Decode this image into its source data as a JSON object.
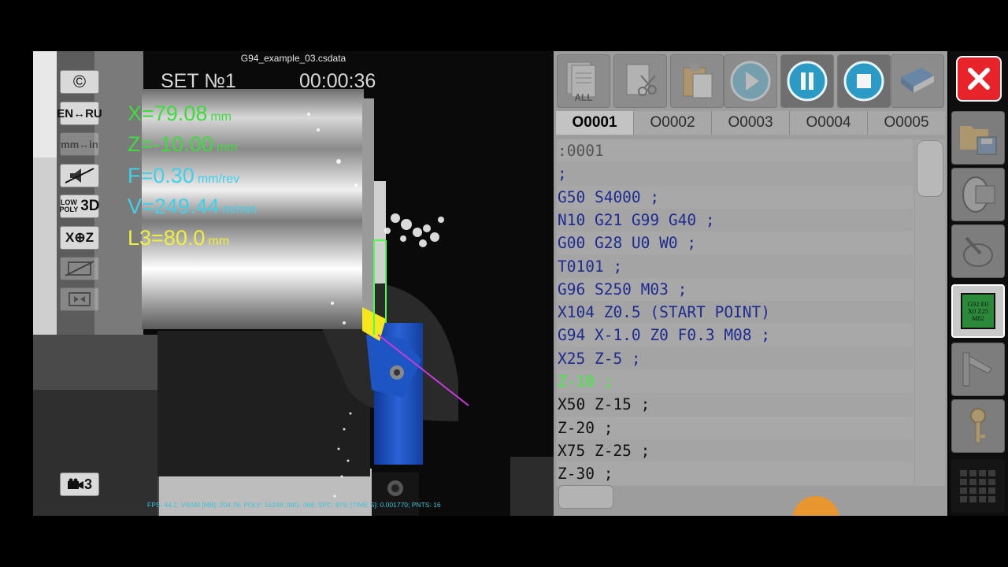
{
  "viewport": {
    "file_name": "G94_example_03.csdata",
    "set_label": "SET №1",
    "timer": "00:00:36",
    "readouts": {
      "x": {
        "text": "X=79.08",
        "unit": "mm",
        "color": "#3ddc3d"
      },
      "z": {
        "text": "Z=-10.00",
        "unit": "mm",
        "color": "#3ddc3d"
      },
      "f": {
        "text": "F=0.30",
        "unit": "mm/rev",
        "color": "#3fd0ea"
      },
      "v": {
        "text": "V=249.44",
        "unit": "m/min",
        "color": "#3fd0ea"
      },
      "l3": {
        "text": "L3=80.0",
        "unit": "mm",
        "color": "#f0f03a"
      }
    },
    "fps_line": "FPS: 44.2; VRAM [MB]: 204.78; POLY: 15249; IMG: 368; SPC: 879; [TIME S]: 0.001770; PNTS: 16",
    "left_buttons": {
      "copyright": "©",
      "lang": "EN↔RU",
      "units": "mm↔in",
      "low": "LOW",
      "poly": "POLY",
      "three_d": "3D",
      "axes": "X⊕Z",
      "camera_count": "3"
    }
  },
  "toolbar": {
    "all_label": "ALL",
    "icons": [
      "file-all-icon",
      "cut-icon",
      "paste-icon",
      "play-icon",
      "pause-icon",
      "stop-icon",
      "book-icon",
      "close-icon"
    ]
  },
  "program_tabs": [
    "O0001",
    "O0002",
    "O0003",
    "O0004",
    "O0005"
  ],
  "active_tab": "O0001",
  "code_lines": [
    {
      "text": ":0001",
      "color": "#555555"
    },
    {
      "text": ";",
      "color": "#1e2b8f"
    },
    {
      "text": "G50 S4000 ;",
      "color": "#1e2b8f"
    },
    {
      "text": "N10 G21 G99 G40 ;",
      "color": "#1e2b8f"
    },
    {
      "text": "G00 G28 U0 W0 ;",
      "color": "#1e2b8f"
    },
    {
      "text": "T0101 ;",
      "color": "#1e2b8f"
    },
    {
      "text": "G96 S250 M03 ;",
      "color": "#1e2b8f"
    },
    {
      "text": "X104 Z0.5 (START POINT)",
      "color": "#1e2b8f"
    },
    {
      "text": "G94 X-1.0 Z0 F0.3 M08 ;",
      "color": "#1e2b8f"
    },
    {
      "text": "X25 Z-5 ;",
      "color": "#1e2b8f"
    },
    {
      "text": "Z-10 ;",
      "color": "#3cf03c"
    },
    {
      "text": "X50 Z-15 ;",
      "color": "#111111"
    },
    {
      "text": "Z-20 ;",
      "color": "#111111"
    },
    {
      "text": "X75 Z-25 ;",
      "color": "#111111"
    },
    {
      "text": "Z-30 ;",
      "color": "#111111"
    }
  ],
  "sidebar_icon": {
    "lines": [
      "G92 E0",
      "X0 Z25",
      "M02"
    ]
  },
  "colors": {
    "panel_bg": "#9d9d9d",
    "accent_red": "#e8232a",
    "tool_blue": "#1b4fb8",
    "path_magenta": "#c93ad9"
  }
}
